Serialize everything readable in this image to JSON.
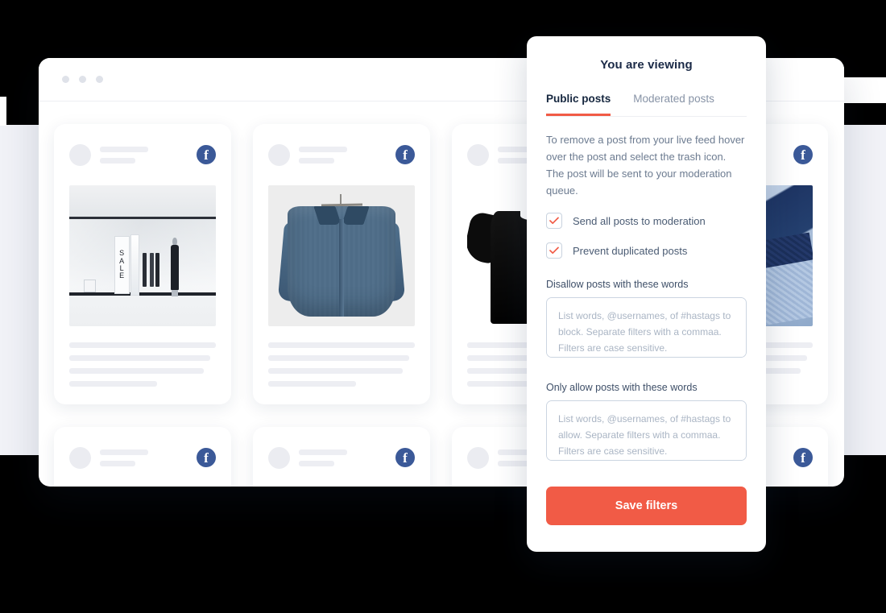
{
  "browser": {
    "window_dots": [
      "dot-1",
      "dot-2",
      "dot-3"
    ]
  },
  "feed": {
    "network_icon": "facebook-icon",
    "network_glyph": "f",
    "rows": [
      {
        "cards": [
          {
            "image_name": "storefront-sale-window",
            "sale_sign_letters": [
              "S",
              "A",
              "L",
              "E"
            ]
          },
          {
            "image_name": "denim-shirt-on-hanger"
          },
          {
            "image_name": "black-tshirt"
          },
          {
            "image_name": "stacked-dress-shirts"
          }
        ]
      },
      {
        "cards": [
          {
            "image_name": "post-placeholder-1"
          },
          {
            "image_name": "post-placeholder-2"
          },
          {
            "image_name": "post-placeholder-3"
          },
          {
            "image_name": "post-placeholder-4"
          }
        ]
      }
    ]
  },
  "panel": {
    "title": "You are viewing",
    "tabs": [
      {
        "label": "Public posts",
        "active": true
      },
      {
        "label": "Moderated posts",
        "active": false
      }
    ],
    "description": "To remove a post from your live feed hover over the post and select the trash icon. The post will be sent to your moderation queue.",
    "checkboxes": [
      {
        "label": "Send all posts to moderation",
        "checked": true
      },
      {
        "label": "Prevent duplicated posts",
        "checked": true
      }
    ],
    "fields": [
      {
        "label": "Disallow posts with these words",
        "value": "",
        "placeholder": "List words, @usernames, of #hastags to block. Separate filters with a commaa. Filters are case sensitive."
      },
      {
        "label": "Only allow posts with these words",
        "value": "",
        "placeholder": "List words, @usernames, of #hastags to allow. Separate filters with a commaa. Filters are case sensitive."
      }
    ],
    "save_label": "Save filters"
  },
  "colors": {
    "accent": "#F15B46",
    "facebook_blue": "#3B5998",
    "panel_title": "#1B2A47",
    "body_text": "#6C7B90",
    "page_band": "#F1F2F7"
  }
}
